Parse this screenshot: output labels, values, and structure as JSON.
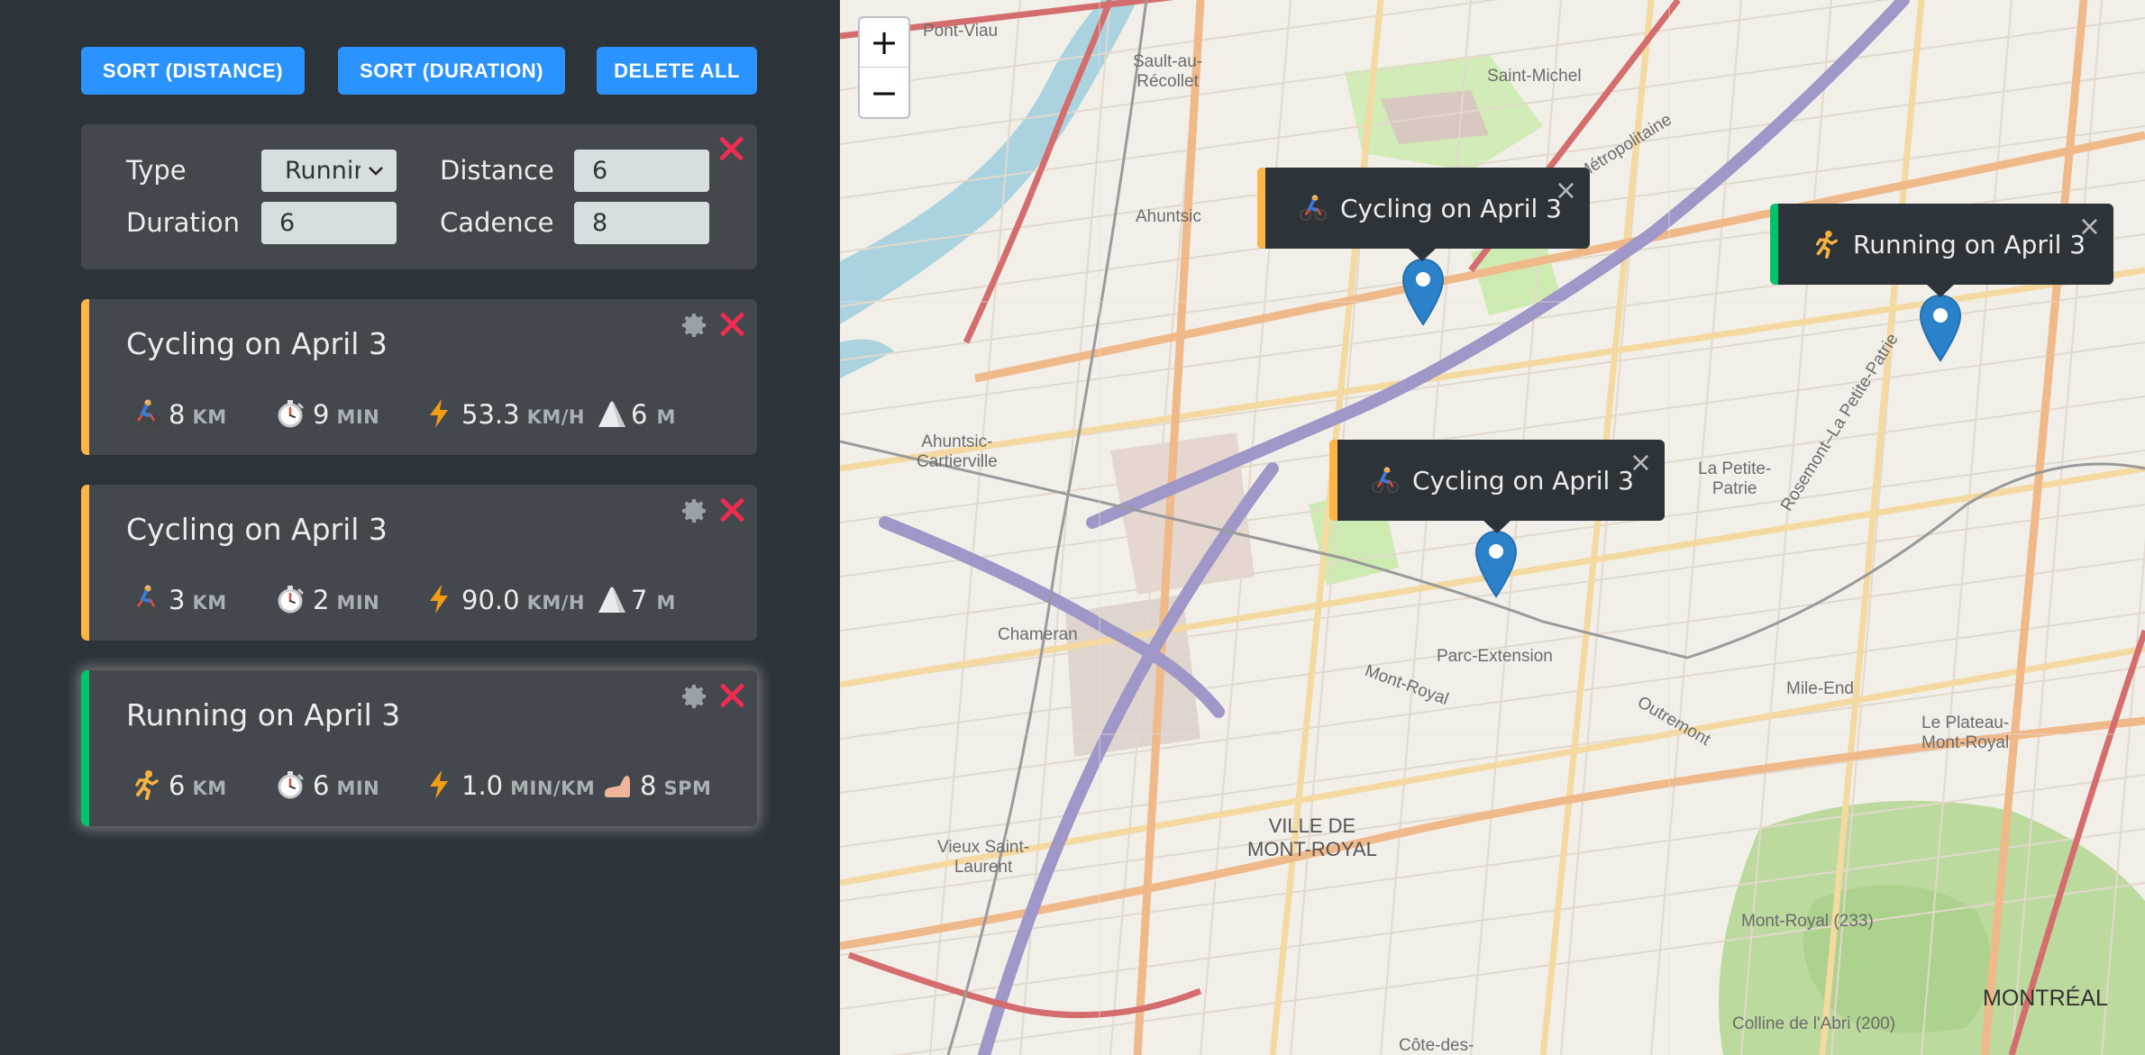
{
  "toolbar": {
    "sort_distance_label": "SORT (DISTANCE)",
    "sort_duration_label": "SORT (DURATION)",
    "delete_all_label": "DELETE ALL"
  },
  "form": {
    "type_label": "Type",
    "type_value": "Running",
    "distance_label": "Distance",
    "distance_value": "6",
    "duration_label": "Duration",
    "duration_value": "6",
    "cadence_label": "Cadence",
    "cadence_value": "8"
  },
  "workouts": [
    {
      "type": "cycling",
      "title": "Cycling on April 3",
      "distance": "8",
      "distance_unit": "KM",
      "duration": "9",
      "duration_unit": "MIN",
      "speed": "53.3",
      "speed_unit": "KM/H",
      "elevation": "6",
      "elevation_unit": "M"
    },
    {
      "type": "cycling",
      "title": "Cycling on April 3",
      "distance": "3",
      "distance_unit": "KM",
      "duration": "2",
      "duration_unit": "MIN",
      "speed": "90.0",
      "speed_unit": "KM/H",
      "elevation": "7",
      "elevation_unit": "M"
    },
    {
      "type": "running",
      "title": "Running on April 3",
      "distance": "6",
      "distance_unit": "KM",
      "duration": "6",
      "duration_unit": "MIN",
      "pace": "1.0",
      "pace_unit": "MIN/KM",
      "cadence": "8",
      "cadence_unit": "SPM"
    }
  ],
  "map": {
    "zoom_in": "+",
    "zoom_out": "−",
    "popups": [
      {
        "type": "cycling",
        "label": "Cycling on April 3",
        "close": "×"
      },
      {
        "type": "running",
        "label": "Running on April 3",
        "close": "×"
      },
      {
        "type": "cycling",
        "label": "Cycling on April 3",
        "close": "×"
      }
    ],
    "labels": {
      "pont_viau": "Pont-Viau",
      "sault_recollet": "Sault-au-\nRécollet",
      "saint_michel": "Saint-Michel",
      "ahuntsic": "Ahuntsic",
      "ahuntsic_cartierville": "Ahuntsic-\nCartierville",
      "chameran": "Chameran",
      "parc_extension": "Parc-Extension",
      "la_petite_patrie": "La Petite-\nPatrie",
      "mile_end": "Mile-End",
      "plateau": "Le Plateau-\nMont-Royal",
      "ville_mont_royal": "VILLE DE\nMONT-ROYAL",
      "vieux_saint_laurent": "Vieux Saint-\nLaurent",
      "mont_royal_233": "Mont-Royal (233)",
      "colline_abri": "Colline de l'Abri (200)",
      "montreal": "MONTRÉAL",
      "cote_des": "Côte-des-",
      "autoroute": "Autoroute Métropolitaine",
      "mont_royal_street": "Mont-Royal",
      "outremont": "Outremont",
      "rosemont_patrie": "Rosemont–La Petite-Patrie"
    }
  },
  "colors": {
    "cycling_accent": "#ffb545",
    "running_accent": "#00c46a",
    "button_blue": "#2a93ff",
    "delete_red": "#ee2c50",
    "sidebar_bg": "#2d3439",
    "card_bg": "#42484d"
  },
  "icons": {
    "cycling": "bicyclist-icon",
    "running": "runner-icon",
    "duration": "stopwatch-icon",
    "speed": "lightning-icon",
    "elevation": "mountain-icon",
    "cadence": "foot-icon",
    "edit": "gear-icon",
    "delete": "close-icon"
  }
}
